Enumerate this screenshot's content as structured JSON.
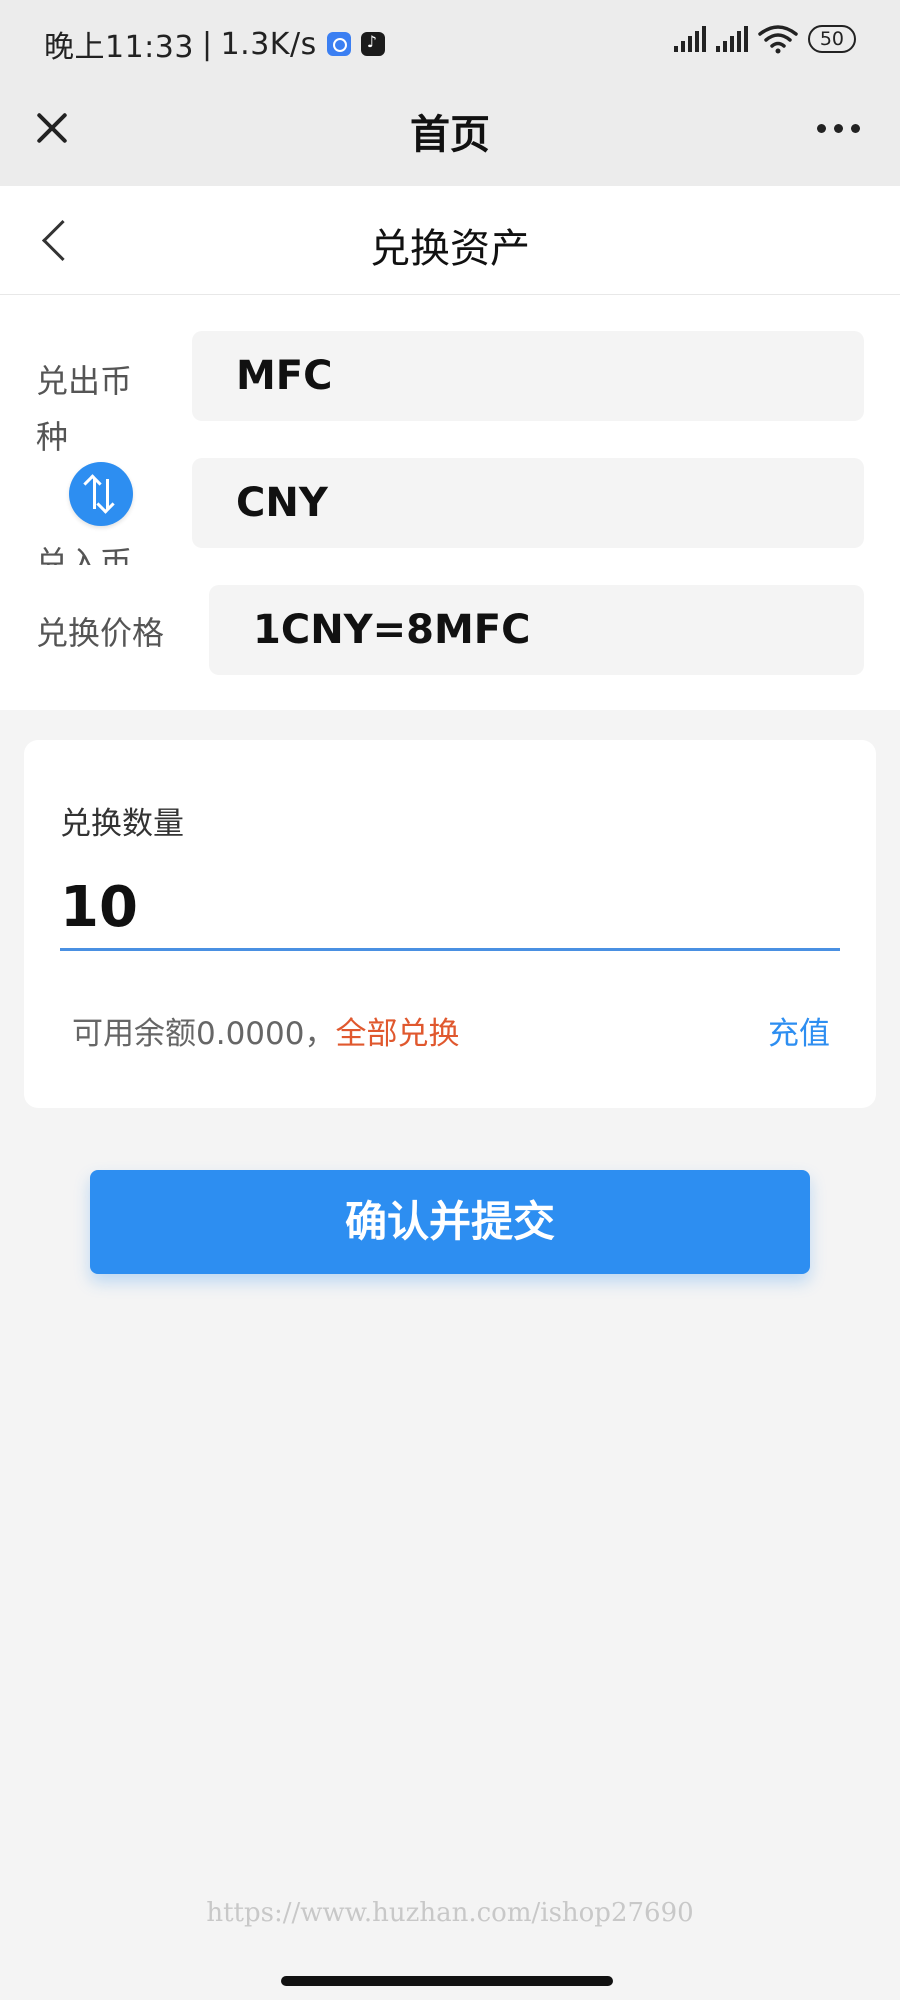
{
  "status_bar": {
    "time": "晚上11:33",
    "separator": "|",
    "network_speed": "1.3K/s",
    "battery": "50",
    "app_icons": [
      "blue-q-app-icon",
      "tiktok-icon"
    ]
  },
  "wx_nav": {
    "title": "首页",
    "close_icon": "close-icon",
    "more_icon": "more-dots-icon"
  },
  "header": {
    "title": "兑换资产",
    "back_icon": "chevron-left-icon"
  },
  "form": {
    "out_currency_label": "兑出币种",
    "out_currency_value": "MFC",
    "in_currency_label": "兑入币",
    "in_currency_value": "CNY",
    "price_label": "兑换价格",
    "price_value": "1CNY=8MFC",
    "swap_icon": "swap-arrows-icon"
  },
  "amount": {
    "label": "兑换数量",
    "value": "10",
    "balance_text": "可用余额0.0000，",
    "exchange_all": "全部兑换",
    "recharge": "充值"
  },
  "submit_label": "确认并提交",
  "watermark": "https://www.huzhan.com/ishop27690",
  "colors": {
    "accent_blue": "#2d8ef1",
    "orange": "#e0582e",
    "input_underline": "#4a90e2",
    "page_bg": "#f4f4f4"
  }
}
